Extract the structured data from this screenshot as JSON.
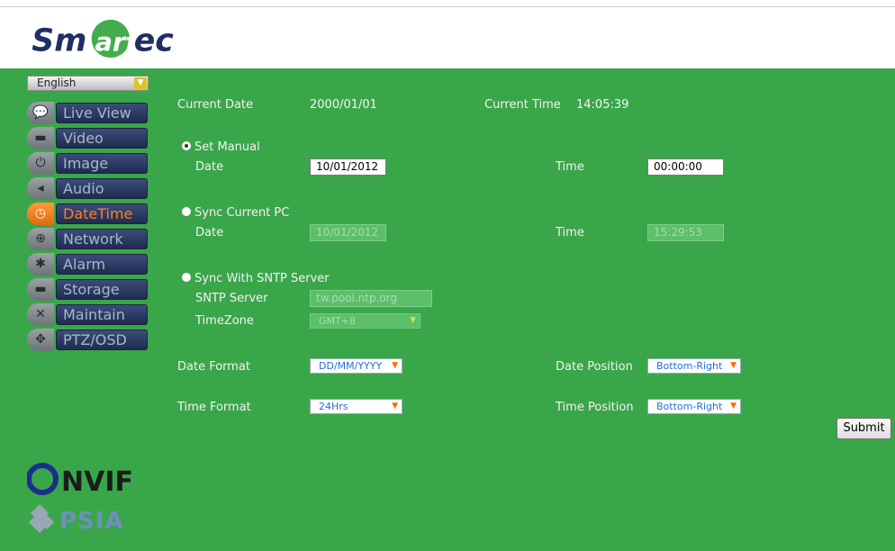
{
  "brand": {
    "logo_text": "Smartec"
  },
  "language": {
    "selected": "English"
  },
  "nav": [
    {
      "label": "Live View",
      "icon": "live-view-icon",
      "glyph": "💬",
      "active": false
    },
    {
      "label": "Video",
      "icon": "video-camera-icon",
      "glyph": "▬",
      "active": false
    },
    {
      "label": "Image",
      "icon": "power-icon",
      "glyph": "⏻",
      "active": false
    },
    {
      "label": "Audio",
      "icon": "speaker-icon",
      "glyph": "◂",
      "active": false
    },
    {
      "label": "DateTime",
      "icon": "clock-icon",
      "glyph": "◷",
      "active": true
    },
    {
      "label": "Network",
      "icon": "globe-icon",
      "glyph": "⊕",
      "active": false
    },
    {
      "label": "Alarm",
      "icon": "star-alarm-icon",
      "glyph": "✱",
      "active": false
    },
    {
      "label": "Storage",
      "icon": "storage-icon",
      "glyph": "▬",
      "active": false
    },
    {
      "label": "Maintain",
      "icon": "tools-icon",
      "glyph": "✕",
      "active": false
    },
    {
      "label": "PTZ/OSD",
      "icon": "ptz-arrows-icon",
      "glyph": "✥",
      "active": false
    }
  ],
  "current": {
    "date_label": "Current Date",
    "date_value": "2000/01/01",
    "time_label": "Current Time",
    "time_value": "14:05:39"
  },
  "manual": {
    "label": "Set Manual",
    "date_label": "Date",
    "date_value": "10/01/2012",
    "time_label": "Time",
    "time_value": "00:00:00"
  },
  "sync_pc": {
    "label": "Sync Current PC",
    "date_label": "Date",
    "date_value": "10/01/2012",
    "time_label": "Time",
    "time_value": "15:29:53"
  },
  "sntp": {
    "label": "Sync With SNTP Server",
    "server_label": "SNTP Server",
    "server_value": "tw.pool.ntp.org",
    "timezone_label": "TimeZone",
    "timezone_value": "GMT+8"
  },
  "format": {
    "date_format_label": "Date Format",
    "date_format_value": "DD/MM/YYYY",
    "date_position_label": "Date Position",
    "date_position_value": "Bottom-Right",
    "time_format_label": "Time Format",
    "time_format_value": "24Hrs",
    "time_position_label": "Time Position",
    "time_position_value": "Bottom-Right"
  },
  "submit_label": "Submit",
  "logos": {
    "onvif": "ONVIF",
    "psia": "PSIA"
  },
  "colors": {
    "background": "#3aa64a",
    "nav_bar": "#2a3a64",
    "active": "#ff7e22"
  }
}
